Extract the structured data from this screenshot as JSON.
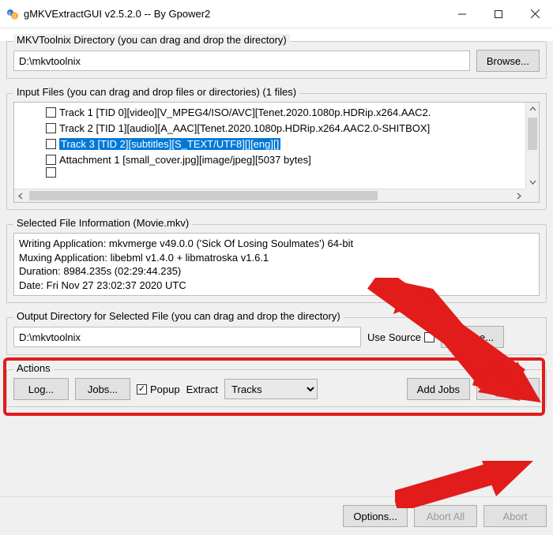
{
  "window": {
    "title": "gMKVExtractGUI v2.5.2.0  --  By Gpower2"
  },
  "mkvdir": {
    "legend": "MKVToolnix Directory (you can drag and drop the directory)",
    "path": "D:\\mkvtoolnix",
    "browse": "Browse..."
  },
  "input": {
    "legend": "Input Files (you can drag and drop files or directories) (1 files)",
    "tracks": [
      {
        "label": "Track 1 [TID 0][video][V_MPEG4/ISO/AVC][Tenet.2020.1080p.HDRip.x264.AAC2.",
        "selected": false
      },
      {
        "label": "Track 2 [TID 1][audio][A_AAC][Tenet.2020.1080p.HDRip.x264.AAC2.0-SHITBOX]",
        "selected": false
      },
      {
        "label": "Track 3 [TID 2][subtitles][S_TEXT/UTF8][][eng][]",
        "selected": true
      },
      {
        "label": "Attachment 1 [small_cover.jpg][image/jpeg][5037 bytes]",
        "selected": false
      }
    ]
  },
  "fileinfo": {
    "legend": "Selected File Information (Movie.mkv)",
    "lines": [
      "Writing Application: mkvmerge v49.0.0 ('Sick Of Losing Soulmates') 64-bit",
      "Muxing Application: libebml v1.4.0 + libmatroska v1.6.1",
      "Duration: 8984.235s (02:29:44.235)",
      "Date: Fri Nov 27 23:02:37 2020 UTC"
    ]
  },
  "output": {
    "legend": "Output Directory for Selected File (you can drag and drop the directory)",
    "path": "D:\\mkvtoolnix",
    "use_source": "Use Source",
    "use_source_checked": false,
    "browse": "Browse..."
  },
  "actions": {
    "legend": "Actions",
    "log": "Log...",
    "jobs": "Jobs...",
    "popup": "Popup",
    "popup_checked": true,
    "extract_label": "Extract",
    "mode": "Tracks",
    "add_jobs": "Add Jobs",
    "extract": "Extract"
  },
  "bottom": {
    "options": "Options...",
    "abort_all": "Abort All",
    "abort": "Abort"
  }
}
